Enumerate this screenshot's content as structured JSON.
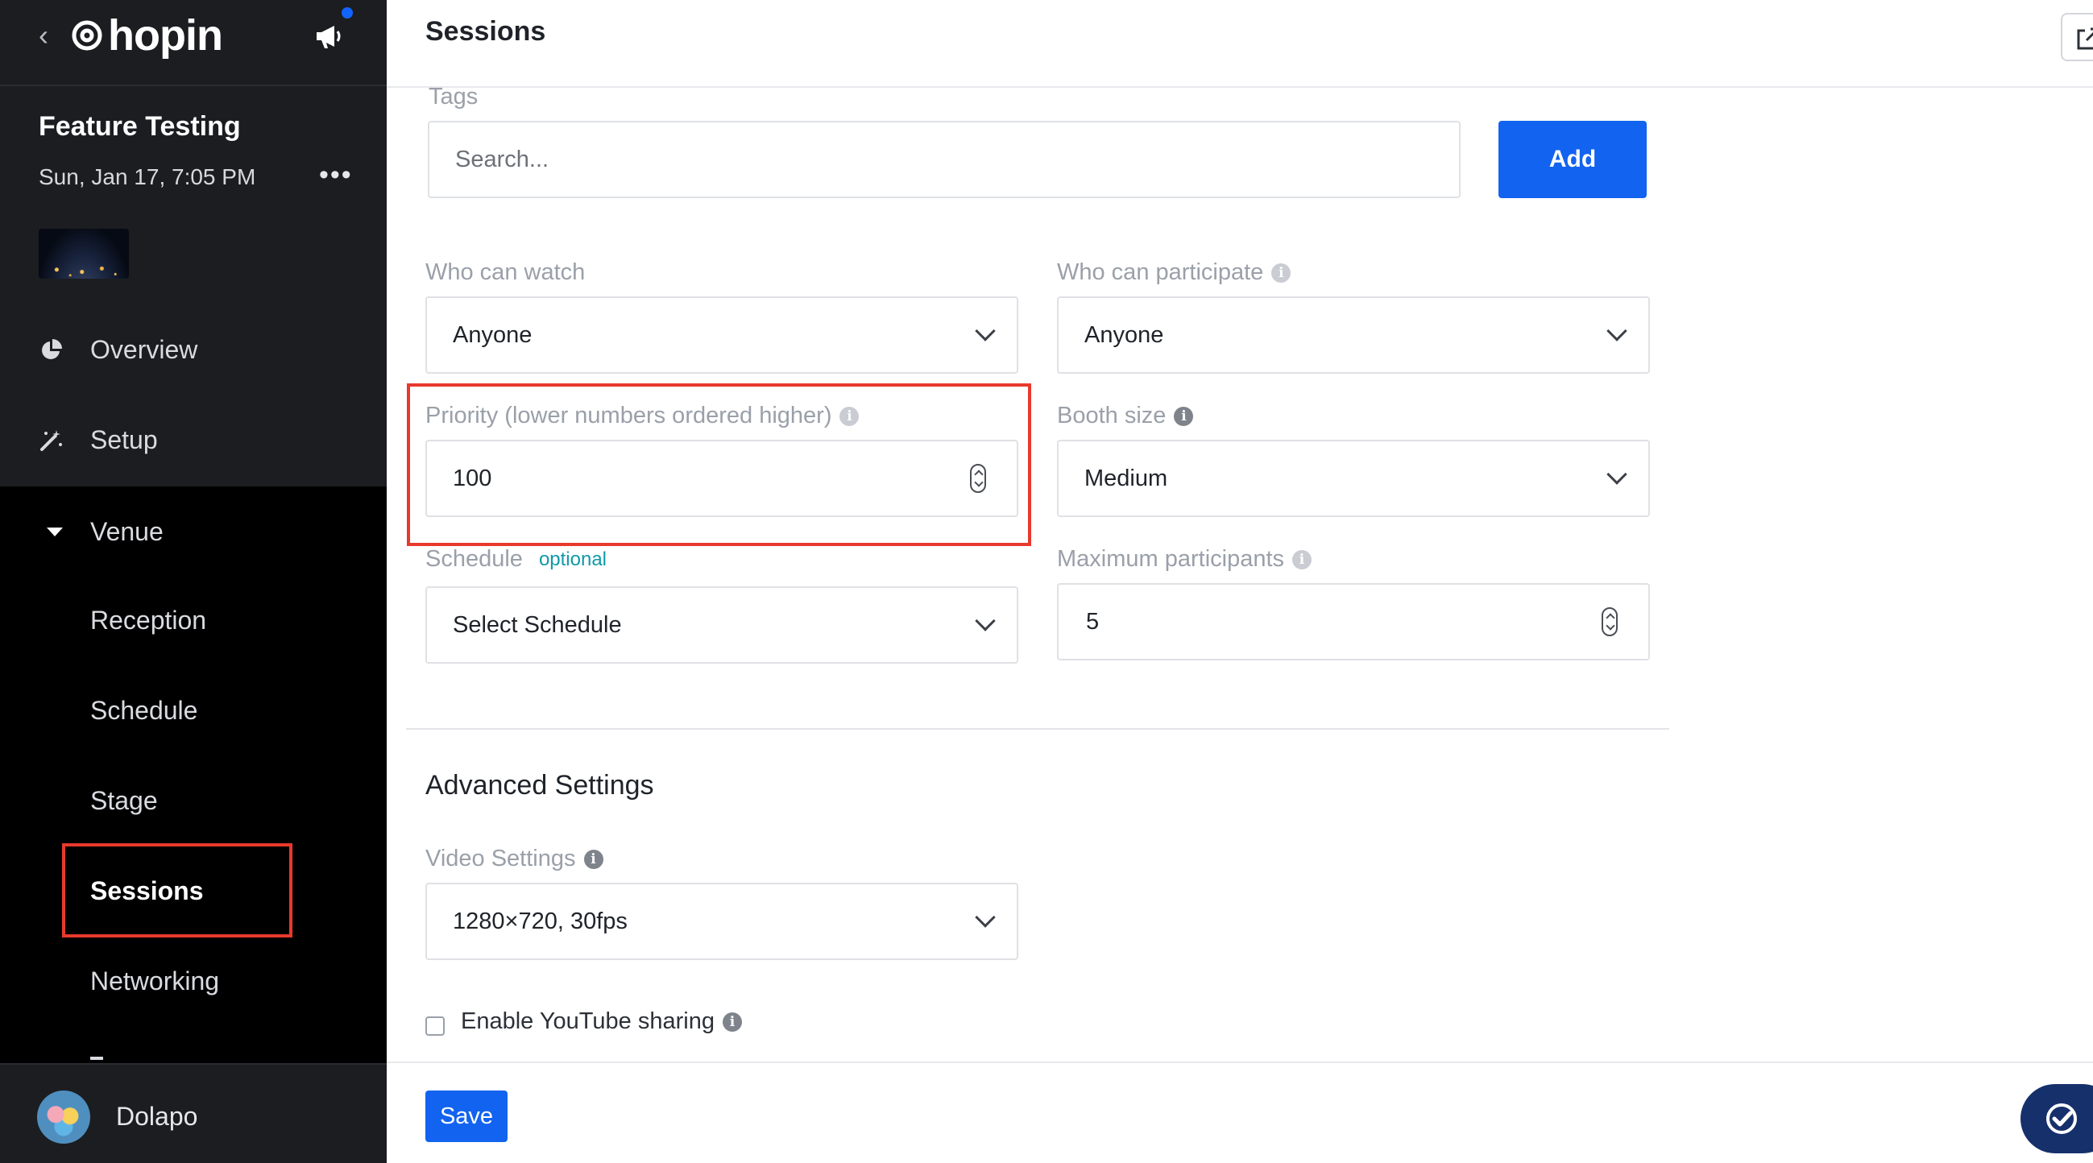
{
  "app": {
    "logo_text": "hopin"
  },
  "event": {
    "title": "Feature Testing",
    "date": "Sun, Jan 17, 7:05 PM"
  },
  "sidebar": {
    "items": [
      {
        "label": "Overview",
        "icon": "pie-chart-icon"
      },
      {
        "label": "Setup",
        "icon": "magic-wand-icon"
      },
      {
        "label": "Venue",
        "icon": "caret-down-icon",
        "expanded": true
      }
    ],
    "venue_items": [
      {
        "label": "Reception"
      },
      {
        "label": "Schedule"
      },
      {
        "label": "Stage"
      },
      {
        "label": "Sessions",
        "active": true
      },
      {
        "label": "Networking"
      }
    ]
  },
  "user": {
    "name": "Dolapo"
  },
  "header": {
    "title": "Sessions"
  },
  "form": {
    "tags": {
      "label": "Tags",
      "placeholder": "Search...",
      "add_label": "Add"
    },
    "who_can_watch": {
      "label": "Who can watch",
      "value": "Anyone"
    },
    "who_can_participate": {
      "label": "Who can participate",
      "value": "Anyone"
    },
    "priority": {
      "label": "Priority (lower numbers ordered higher)",
      "value": "100"
    },
    "booth_size": {
      "label": "Booth size",
      "value": "Medium"
    },
    "schedule": {
      "label": "Schedule",
      "optional": "optional",
      "value": "Select Schedule"
    },
    "max_participants": {
      "label": "Maximum participants",
      "value": "5"
    },
    "advanced": {
      "title": "Advanced Settings",
      "video_settings": {
        "label": "Video Settings",
        "value": "1280×720, 30fps"
      },
      "youtube": {
        "label": "Enable YouTube sharing",
        "checked": false
      }
    }
  },
  "footer": {
    "save_label": "Save"
  },
  "colors": {
    "primary": "#1263ef",
    "highlight": "#e8392c",
    "sidebar_bg": "#1c1d21",
    "venue_bg": "#000000",
    "optional_text": "#0f9aa8"
  }
}
